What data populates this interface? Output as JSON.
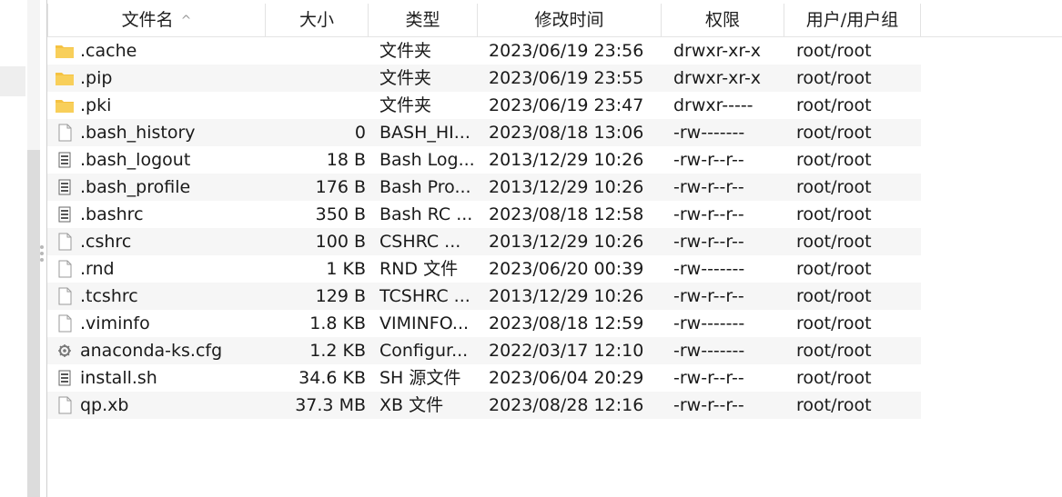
{
  "columns": {
    "name": "文件名",
    "size": "大小",
    "type": "类型",
    "mtime": "修改时间",
    "perm": "权限",
    "owner": "用户/用户组"
  },
  "colors": {
    "folder": "#f5c242",
    "alt_row": "#f6f6f6"
  },
  "files": [
    {
      "icon": "folder-icon",
      "name": ".cache",
      "size": "",
      "type": "文件夹",
      "mtime": "2023/06/19 23:56",
      "perm": "drwxr-xr-x",
      "owner": "root/root"
    },
    {
      "icon": "folder-icon",
      "name": ".pip",
      "size": "",
      "type": "文件夹",
      "mtime": "2023/06/19 23:55",
      "perm": "drwxr-xr-x",
      "owner": "root/root"
    },
    {
      "icon": "folder-icon",
      "name": ".pki",
      "size": "",
      "type": "文件夹",
      "mtime": "2023/06/19 23:47",
      "perm": "drwxr-----",
      "owner": "root/root"
    },
    {
      "icon": "file-icon",
      "name": ".bash_history",
      "size": "0",
      "type": "BASH_HI...",
      "mtime": "2023/08/18 13:06",
      "perm": "-rw-------",
      "owner": "root/root"
    },
    {
      "icon": "script-icon",
      "name": ".bash_logout",
      "size": "18 B",
      "type": "Bash Log...",
      "mtime": "2013/12/29 10:26",
      "perm": "-rw-r--r--",
      "owner": "root/root"
    },
    {
      "icon": "script-icon",
      "name": ".bash_profile",
      "size": "176 B",
      "type": "Bash Pro...",
      "mtime": "2013/12/29 10:26",
      "perm": "-rw-r--r--",
      "owner": "root/root"
    },
    {
      "icon": "script-icon",
      "name": ".bashrc",
      "size": "350 B",
      "type": "Bash RC ...",
      "mtime": "2023/08/18 12:58",
      "perm": "-rw-r--r--",
      "owner": "root/root"
    },
    {
      "icon": "file-icon",
      "name": ".cshrc",
      "size": "100 B",
      "type": "CSHRC ...",
      "mtime": "2013/12/29 10:26",
      "perm": "-rw-r--r--",
      "owner": "root/root"
    },
    {
      "icon": "file-icon",
      "name": ".rnd",
      "size": "1 KB",
      "type": "RND 文件",
      "mtime": "2023/06/20 00:39",
      "perm": "-rw-------",
      "owner": "root/root"
    },
    {
      "icon": "file-icon",
      "name": ".tcshrc",
      "size": "129 B",
      "type": "TCSHRC ...",
      "mtime": "2013/12/29 10:26",
      "perm": "-rw-r--r--",
      "owner": "root/root"
    },
    {
      "icon": "file-icon",
      "name": ".viminfo",
      "size": "1.8 KB",
      "type": "VIMINFO...",
      "mtime": "2023/08/18 12:59",
      "perm": "-rw-------",
      "owner": "root/root"
    },
    {
      "icon": "config-file-icon",
      "name": "anaconda-ks.cfg",
      "size": "1.2 KB",
      "type": "Configur...",
      "mtime": "2022/03/17 12:10",
      "perm": "-rw-------",
      "owner": "root/root"
    },
    {
      "icon": "script-icon",
      "name": "install.sh",
      "size": "34.6 KB",
      "type": "SH 源文件",
      "mtime": "2023/06/04 20:29",
      "perm": "-rw-r--r--",
      "owner": "root/root"
    },
    {
      "icon": "file-icon",
      "name": "qp.xb",
      "size": "37.3 MB",
      "type": "XB 文件",
      "mtime": "2023/08/28 12:16",
      "perm": "-rw-r--r--",
      "owner": "root/root"
    }
  ]
}
